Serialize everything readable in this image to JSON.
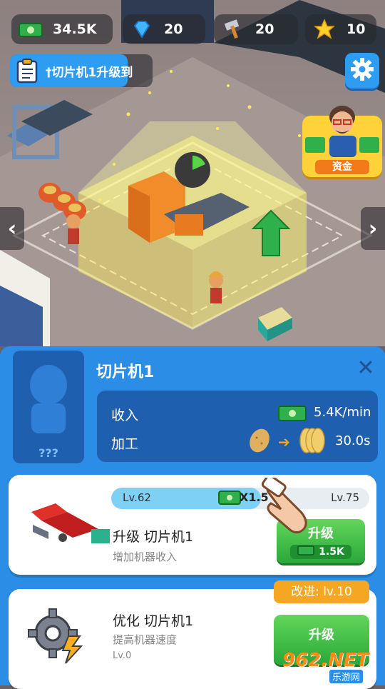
{
  "hud": {
    "cash": "34.5K",
    "gems": "20",
    "hammers": "20",
    "stars": "10"
  },
  "quest": {
    "text": "†切片机1升级到"
  },
  "manager": {
    "label": "资金"
  },
  "machine": {
    "title": "切片机1",
    "portrait_label": "???",
    "income_label": "收入",
    "income_value": "5.4K/min",
    "process_label": "加工",
    "process_time": "30.0s"
  },
  "upgrade": {
    "lv_current": "Lv.62",
    "lv_target": "Lv.75",
    "multiplier": "X1.5",
    "progress": 0.58,
    "title": "升级 切片机1",
    "subtitle": "增加机器收入",
    "button_label": "升级",
    "button_cost": "1.5K"
  },
  "optimize": {
    "title": "优化 切片机1",
    "subtitle": "提高机器速度",
    "level": "Lv.0",
    "improve_badge": "改进: lv.10",
    "button_label": "升级"
  },
  "watermark": {
    "brand": "962.NET",
    "sub": "乐游网"
  },
  "colors": {
    "panel_blue": "#2b8de6",
    "dark_blue": "#1f5fb0",
    "green": "#2aa83a",
    "orange": "#f5a623"
  }
}
